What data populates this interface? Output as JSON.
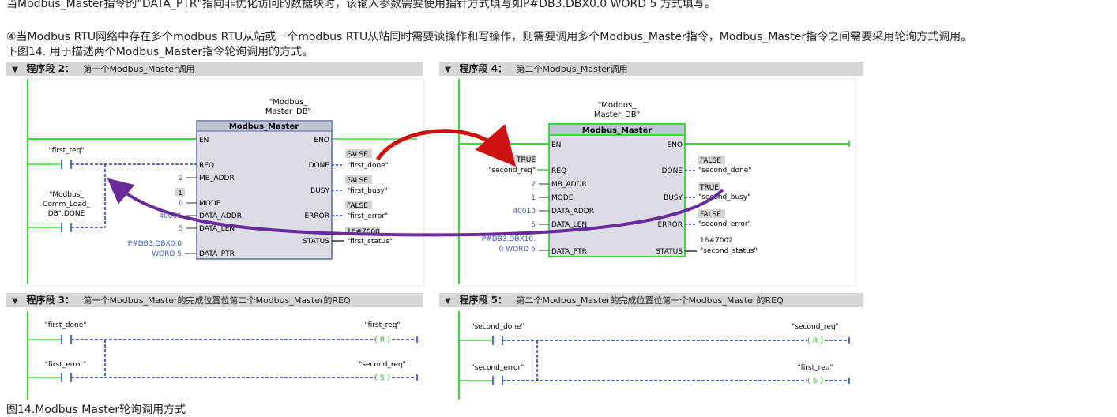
{
  "text": {
    "line1": "当Modbus_Master指令的\"DATA_PTR\"指向非优化访问的数据块时，该输入参数需要使用指针方式填写如P#DB3.DBX0.0 WORD 5 方式填写。",
    "line2": "④当Modbus RTU网络中存在多个modbus RTU从站或一个modbus RTU从站同时需要读操作和写操作，则需要调用多个Modbus_Master指令，Modbus_Master指令之间需要采用轮询方式调用。",
    "line3": "下图14. 用于描述两个Modbus_Master指令轮询调用的方式。",
    "caption": "图14.Modbus  Master轮询调用方式"
  },
  "segments": {
    "s2": {
      "num": "程序段 2：",
      "title": "第一个Modbus_Master调用"
    },
    "s4": {
      "num": "程序段 4：",
      "title": "第二个Modbus_Master调用"
    },
    "s3": {
      "num": "程序段 3：",
      "title": "第一个Modbus_Master的完成位置位第二个Modbus_Master的REQ"
    },
    "s5": {
      "num": "程序段 5：",
      "title": "第二个Modbus_Master的完成位置位第一个Modbus_Master的REQ"
    }
  },
  "block1": {
    "db1": "\"Modbus_",
    "db2": "Master_DB\"",
    "name": "Modbus_Master",
    "en": "EN",
    "eno": "ENO",
    "req": "REQ",
    "mb_addr": "MB_ADDR",
    "mode": "MODE",
    "data_addr": "DATA_ADDR",
    "data_len": "DATA_LEN",
    "data_ptr": "DATA_PTR",
    "done": "DONE",
    "busy": "BUSY",
    "error": "ERROR",
    "status": "STATUS",
    "req_tag": "\"first_req\"",
    "load1": "\"Modbus_",
    "load2": "Comm_Load_",
    "load3": "DB\".DONE",
    "mb_addr_val": "2",
    "mode_val": "0",
    "mode_mon": "1",
    "data_addr_val": "40001",
    "data_len_val": "5",
    "ptr1": "P#DB3.DBX0.0",
    "ptr2": "WORD 5",
    "done_mon": "FALSE",
    "done_tag": "\"first_done\"",
    "busy_mon": "FALSE",
    "busy_tag": "\"first_busy\"",
    "error_mon": "FALSE",
    "error_tag": "\"first_error\"",
    "status_mon": "16#7000",
    "status_tag": "\"first_status\""
  },
  "block2": {
    "db1": "\"Modbus_",
    "db2": "Master_DB\"",
    "name": "Modbus_Master",
    "en": "EN",
    "eno": "ENO",
    "req": "REQ",
    "mb_addr": "MB_ADDR",
    "mode": "MODE",
    "data_addr": "DATA_ADDR",
    "data_len": "DATA_LEN",
    "data_ptr": "DATA_PTR",
    "done": "DONE",
    "busy": "BUSY",
    "error": "ERROR",
    "status": "STATUS",
    "req_mon": "TRUE",
    "req_tag": "\"second_req\"",
    "mb_addr_val": "2",
    "mode_val": "1",
    "data_addr_val": "40010",
    "data_len_val": "5",
    "ptr1": "P#DB3.DBX10.",
    "ptr2": "0 WORD 5",
    "done_mon": "FALSE",
    "done_tag": "\"second_done\"",
    "busy_mon": "TRUE",
    "busy_tag": "\"second_busy\"",
    "error_mon": "FALSE",
    "error_tag": "\"second_error\"",
    "status_mon": "16#7002",
    "status_tag": "\"second_status\""
  },
  "net3": {
    "c1": "\"first_done\"",
    "c2": "\"first_error\"",
    "coil1": "\"first_req\"",
    "coil1_type": "R",
    "coil2": "\"second_req\"",
    "coil2_type": "S"
  },
  "net5": {
    "c1": "\"second_done\"",
    "c2": "\"second_error\"",
    "coil1": "\"second_req\"",
    "coil1_type": "R",
    "coil2": "\"first_req\"",
    "coil2_type": "S"
  },
  "colors": {
    "rail": "#33dd33",
    "wire": "#1a3fb0",
    "block_fill": "#dcdce6",
    "block_hdr": "#bfc3d6",
    "arrow_red": "#cc1111",
    "arrow_purple": "#6a2a9a",
    "mon_bg": "#d4d4d4"
  }
}
